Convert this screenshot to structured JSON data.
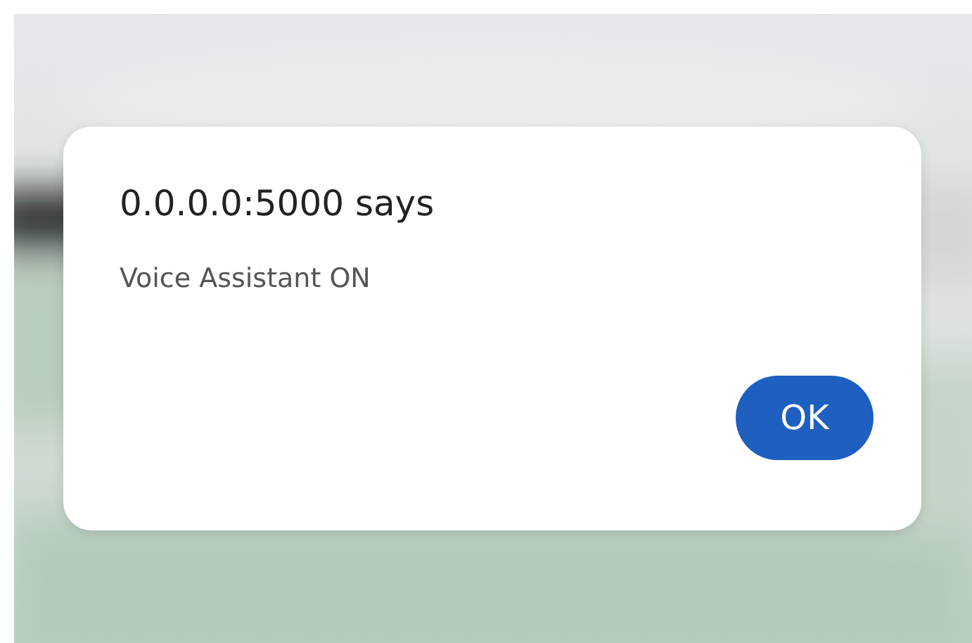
{
  "dialog": {
    "title": "0.0.0.0:5000 says",
    "message": "Voice Assistant ON",
    "buttons": [
      "OK"
    ]
  }
}
